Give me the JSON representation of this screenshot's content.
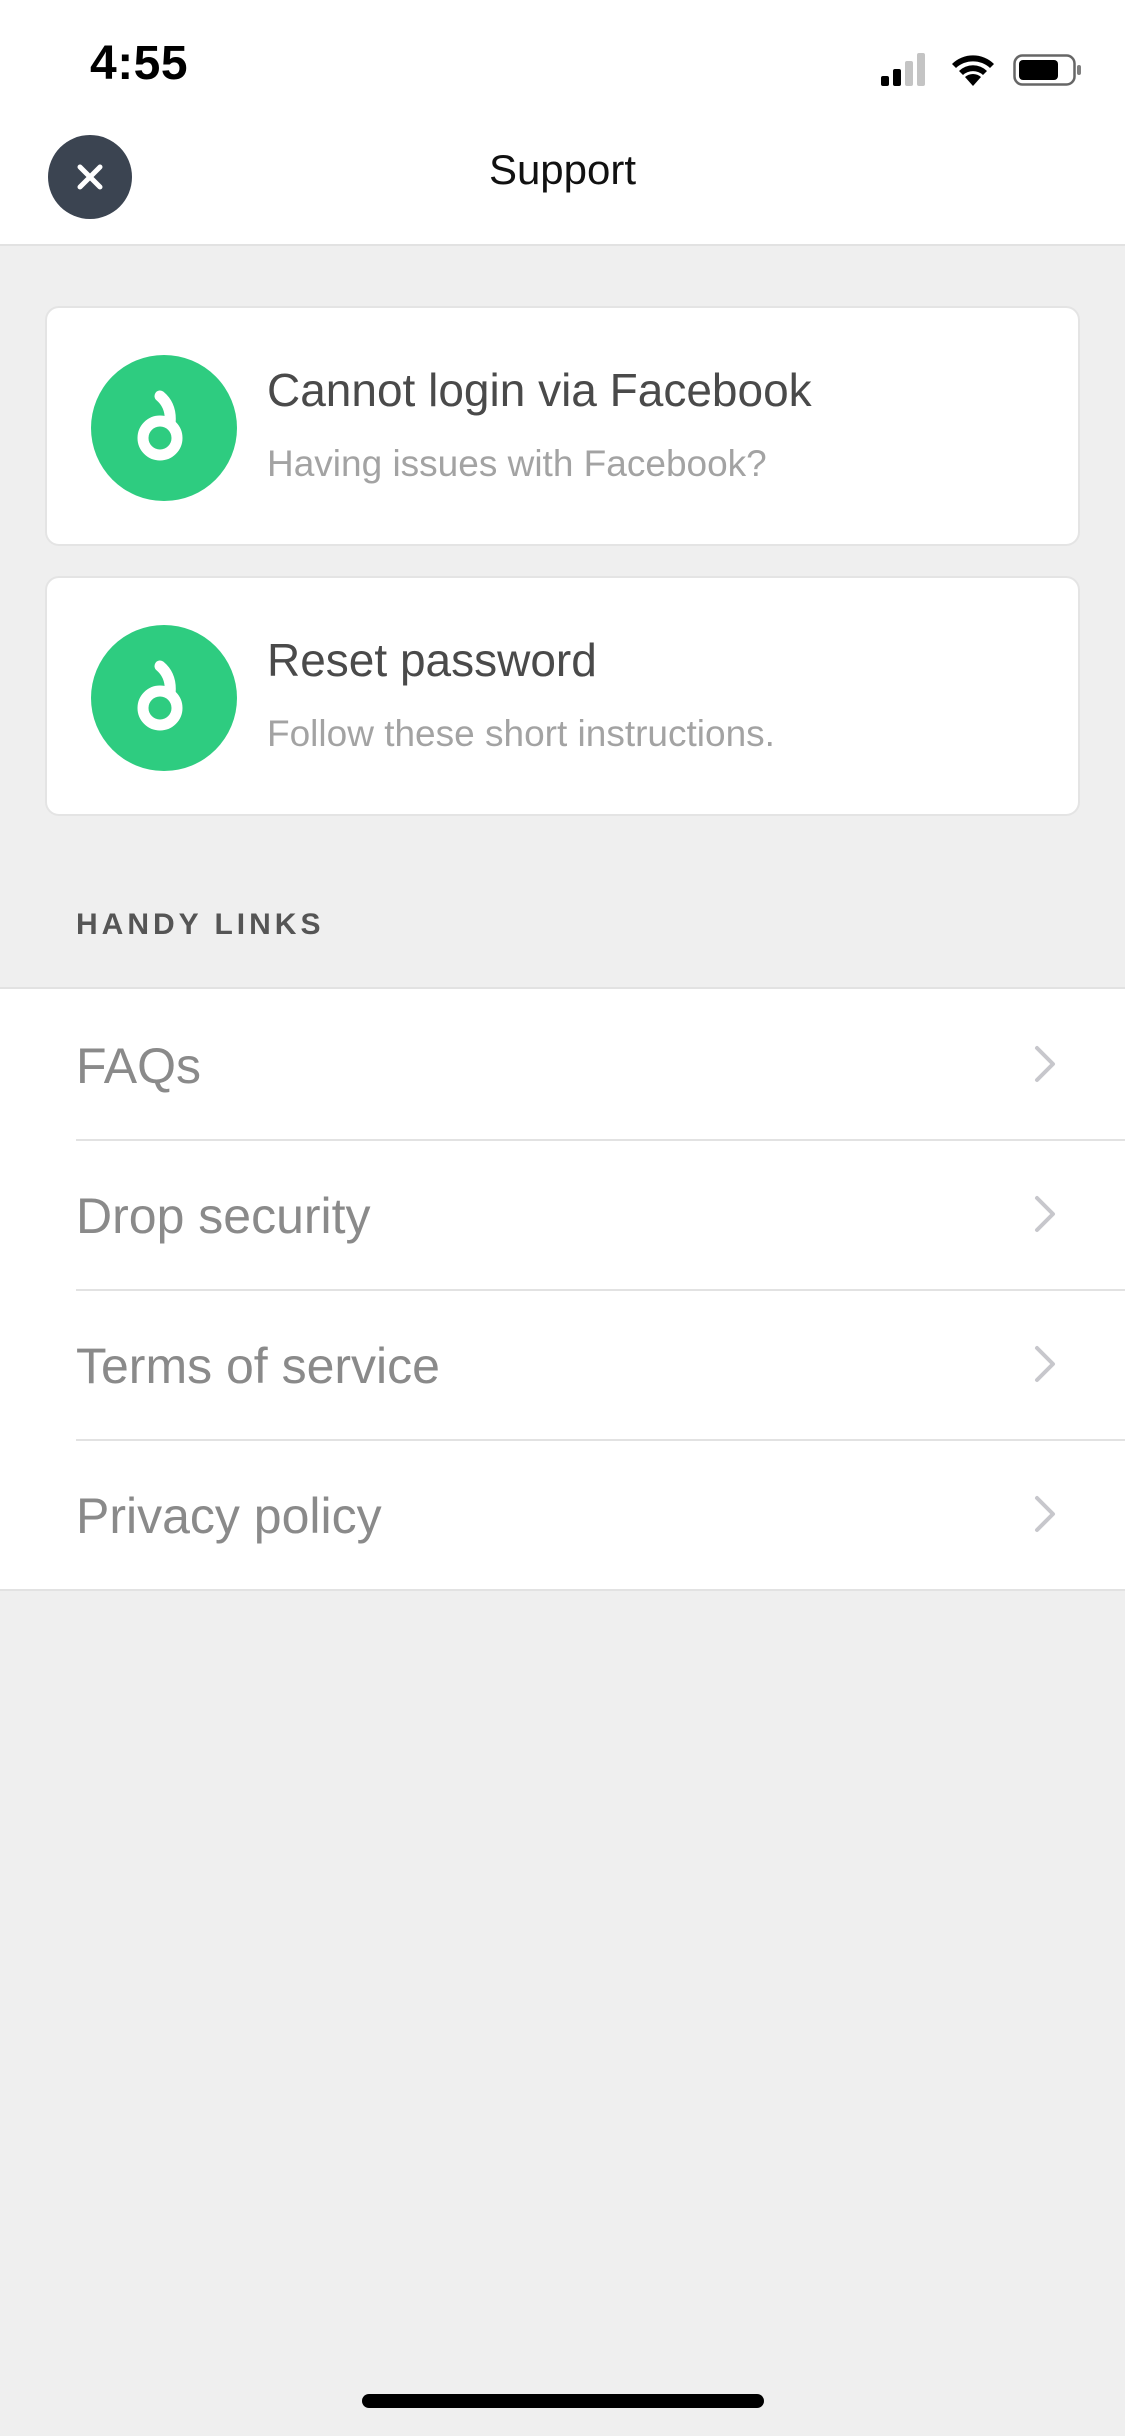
{
  "status_bar": {
    "time": "4:55",
    "icons": [
      "cellular-signal-icon",
      "wifi-icon",
      "battery-icon"
    ]
  },
  "nav": {
    "title": "Support",
    "close_icon": "close-icon"
  },
  "cards": [
    {
      "title": "Cannot login via Facebook",
      "subtitle": "Having issues with Facebook?",
      "icon": "drop-logo-icon"
    },
    {
      "title": "Reset password",
      "subtitle": "Follow these short instructions.",
      "icon": "drop-logo-icon"
    }
  ],
  "handy_links": {
    "header": "HANDY LINKS",
    "items": [
      {
        "label": "FAQs"
      },
      {
        "label": "Drop security"
      },
      {
        "label": "Terms of service"
      },
      {
        "label": "Privacy policy"
      }
    ]
  },
  "colors": {
    "accent": "#2ecc80",
    "close_button": "#3b4451",
    "background": "#efefef"
  }
}
